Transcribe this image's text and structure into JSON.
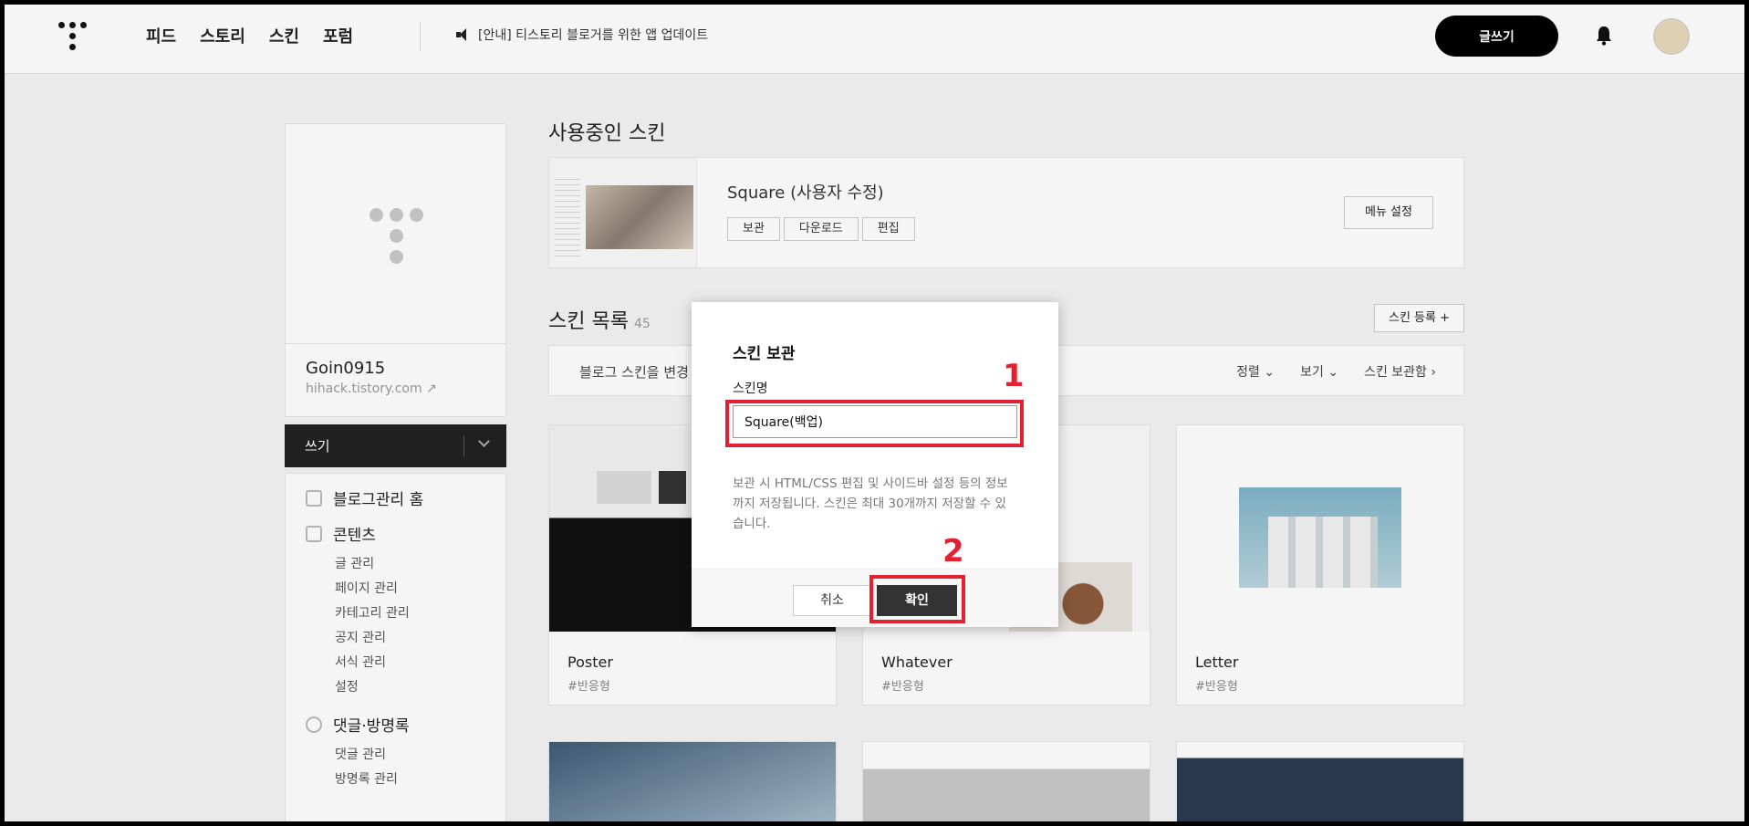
{
  "header": {
    "nav": [
      "피드",
      "스토리",
      "스킨",
      "포럼"
    ],
    "notice": "[안내] 티스토리 블로거를 위한 앱 업데이트",
    "write_label": "글쓰기"
  },
  "sidebar": {
    "blog_name": "Goin0915",
    "blog_url": "hihack.tistory.com",
    "write_label": "쓰기",
    "home_label": "블로그관리 홈",
    "contents_label": "콘텐츠",
    "contents_items": [
      "글 관리",
      "페이지 관리",
      "카테고리 관리",
      "공지 관리",
      "서식 관리",
      "설정"
    ],
    "comments_label": "댓글·방명록",
    "comments_items": [
      "댓글 관리",
      "방명록 관리"
    ]
  },
  "main": {
    "current_title": "사용중인 스킨",
    "current_skin_name": "Square (사용자 수정)",
    "current_buttons": [
      "보관",
      "다운로드",
      "편집"
    ],
    "menu_setting": "메뉴 설정",
    "list_title": "스킨 목록",
    "list_count": "45",
    "register_label": "스킨 등록 +",
    "filter_text": "블로그 스킨을 변경",
    "filter_options": [
      "정렬",
      "보기",
      "스킨 보관함"
    ],
    "cards": [
      {
        "name": "Poster",
        "tag": "#반응형"
      },
      {
        "name": "Whatever",
        "tag": "#반응형"
      },
      {
        "name": "Letter",
        "tag": "#반응형"
      }
    ]
  },
  "modal": {
    "title": "스킨 보관",
    "field_label": "스킨명",
    "input_value": "Square(백업)",
    "description": "보관 시 HTML/CSS 편집 및 사이드바 설정 등의 정보까지 저장됩니다. 스킨은 최대 30개까지 저장할 수 있습니다.",
    "cancel_label": "취소",
    "ok_label": "확인"
  },
  "annotations": [
    "1",
    "2"
  ],
  "colors": {
    "highlight": "#e32130",
    "primary_button": "#333333"
  }
}
